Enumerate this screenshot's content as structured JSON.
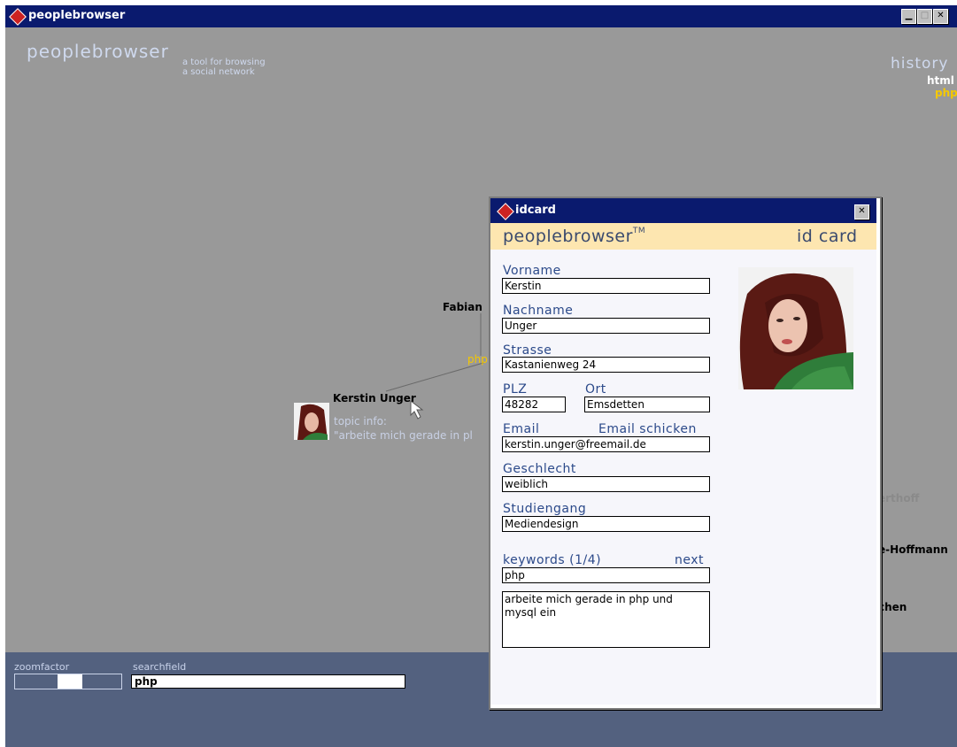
{
  "app": {
    "window_title": "peoplebrowser",
    "brand": "peoplebrowser",
    "tagline_1": "a tool for browsing",
    "tagline_2": "a social network"
  },
  "history": {
    "label": "history",
    "items": [
      "html",
      "php"
    ]
  },
  "graph": {
    "nodes": [
      {
        "label": "Fabian"
      },
      {
        "label": "Kerstin Unger"
      },
      {
        "label": "erthoff"
      },
      {
        "label": "e-Hoffmann"
      },
      {
        "label": "chen"
      }
    ],
    "edge_keyword": "php",
    "topic_label": "topic info:",
    "topic_text": "\"arbeite mich gerade in pl"
  },
  "bottom": {
    "zoom_label": "zoomfactor",
    "search_label": "searchfield",
    "search_value": "php"
  },
  "idcard": {
    "window_title": "idcard",
    "brand": "peoplebrowser",
    "tm": "TM",
    "card_label": "id card",
    "fields": {
      "vorname_label": "Vorname",
      "vorname": "Kerstin",
      "nachname_label": "Nachname",
      "nachname": "Unger",
      "strasse_label": "Strasse",
      "strasse": "Kastanienweg 24",
      "plz_label": "PLZ",
      "plz": "48282",
      "ort_label": "Ort",
      "ort": "Emsdetten",
      "email_label": "Email",
      "email_send": "Email schicken",
      "email": "kerstin.unger@freemail.de",
      "geschlecht_label": "Geschlecht",
      "geschlecht": "weiblich",
      "studiengang_label": "Studiengang",
      "studiengang": "Mediendesign",
      "keywords_label": "keywords (1/4)",
      "next_label": "next",
      "keyword": "php",
      "keyword_text": "arbeite mich gerade in php und mysql ein"
    }
  },
  "colors": {
    "titlebar": "#0a1a6e",
    "canvas": "#999999",
    "bottombar": "#53617f",
    "idcard_header": "#fde6b0",
    "keyword": "#f5c800"
  }
}
